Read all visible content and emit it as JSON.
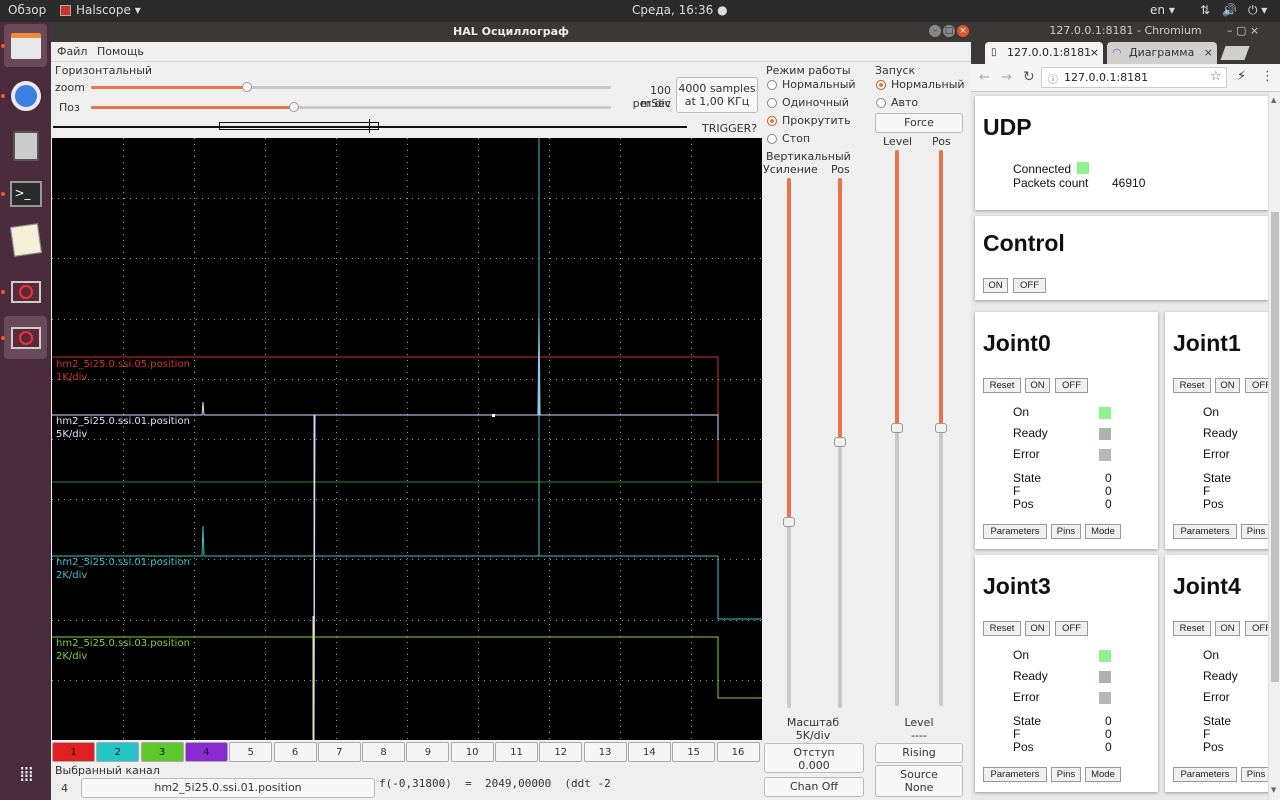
{
  "topbar": {
    "overview": "Обзор",
    "app": "Halscope",
    "clock": "Среда, 16:36",
    "lang": "en"
  },
  "halscope": {
    "title": "HAL Осциллограф",
    "menu": [
      "Файл",
      "Помощь"
    ],
    "horizontal": {
      "section": "Горизонтальный",
      "zoom_label": "zoom",
      "pos_label": "Поз",
      "rate": "100 mSec",
      "rate2": "per div",
      "samples": "4000 samples",
      "samples2": "at 1,00 КГц",
      "trigger": "TRIGGER?",
      "zoom_value": 0.3,
      "pos_value": 0.39
    },
    "mode": {
      "section": "Режим работы",
      "options": [
        "Нормальный",
        "Одиночный",
        "Прокрутить",
        "Стоп"
      ],
      "selected": 2
    },
    "run": {
      "section": "Запуск",
      "options": [
        "Нормальный",
        "Авто"
      ],
      "selected": 0,
      "force": "Force",
      "level": "Level",
      "pos": "Pos"
    },
    "vertical": {
      "section": "Вертикальный",
      "gain": "Усиление",
      "pos": "Pos",
      "scale_label": "Масштаб",
      "scale_value": "5K/div",
      "offset_label": "Отступ",
      "offset_value": "0.000",
      "chan_off": "Chan Off"
    },
    "trigger_panel": {
      "level_label": "Level",
      "level_value": "----",
      "edge": "Rising",
      "source_label": "Source",
      "source_value": "None"
    },
    "channels": [
      "1",
      "2",
      "3",
      "4",
      "5",
      "6",
      "7",
      "8",
      "9",
      "10",
      "11",
      "12",
      "13",
      "14",
      "15",
      "16"
    ],
    "selected_channel": {
      "label": "Выбранный канал",
      "number": "4",
      "name": "hm2_5i25.0.ssi.01.position",
      "readout": "f(-0,31800)  =  2049,00000  (ddt -2"
    },
    "traces": [
      {
        "name": "hm2_5i25.0.ssi.05.position",
        "scale": "1K/div",
        "color": "#d4312d"
      },
      {
        "name": "hm2_5i25.0.ssi.01.position",
        "scale": "5K/div",
        "color": "#c8c8ff"
      },
      {
        "name": "hm2_5i25.0.ssi.01.position",
        "scale": "2K/div",
        "color": "#3cc0c8"
      },
      {
        "name": "hm2_5i25.0.ssi.03.position",
        "scale": "2K/div",
        "color": "#7ed23c"
      }
    ]
  },
  "chromium": {
    "window_title": "127.0.0.1:8181 - Chromium",
    "tabs": [
      "127.0.0.1:8181",
      "Диаграмма"
    ],
    "url": "127.0.0.1:8181",
    "udp": {
      "title": "UDP",
      "connected": "Connected",
      "packets_label": "Packets count",
      "packets_value": "46910"
    },
    "control": {
      "title": "Control",
      "on": "ON",
      "off": "OFF"
    },
    "joints": [
      {
        "title": "Joint0",
        "reset": "Reset",
        "on": "ON",
        "off": "OFF",
        "rows": [
          "On",
          "Ready",
          "Error"
        ],
        "state": "State",
        "f": "F",
        "pos": "Pos",
        "state_v": "0",
        "f_v": "0",
        "pos_v": "0",
        "parameters": "Parameters",
        "pins": "Pins",
        "mode": "Mode"
      },
      {
        "title": "Joint1",
        "reset": "Reset",
        "on": "ON",
        "off": "OFF",
        "rows": [
          "On",
          "Ready",
          "Error"
        ],
        "state": "State",
        "f": "F",
        "pos": "Pos",
        "parameters": "Parameters",
        "pins": "Pins"
      },
      {
        "title": "Joint3",
        "reset": "Reset",
        "on": "ON",
        "off": "OFF",
        "rows": [
          "On",
          "Ready",
          "Error"
        ],
        "state": "State",
        "f": "F",
        "pos": "Pos",
        "state_v": "0",
        "f_v": "0",
        "pos_v": "0",
        "parameters": "Parameters",
        "pins": "Pins",
        "mode": "Mode"
      },
      {
        "title": "Joint4",
        "reset": "Reset",
        "on": "ON",
        "off": "OFF",
        "rows": [
          "On",
          "Ready",
          "Error"
        ],
        "state": "State",
        "f": "F",
        "pos": "Pos",
        "parameters": "Parameters",
        "pins": "Pins"
      }
    ]
  }
}
